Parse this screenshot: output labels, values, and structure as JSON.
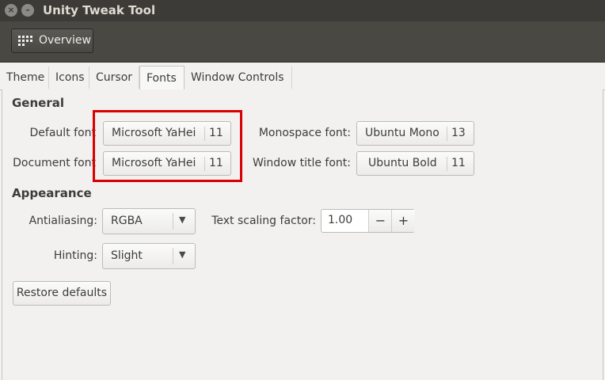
{
  "window": {
    "title": "Unity Tweak Tool"
  },
  "toolbar": {
    "overview_label": "Overview"
  },
  "tabs": [
    {
      "label": "Theme"
    },
    {
      "label": "Icons"
    },
    {
      "label": "Cursor"
    },
    {
      "label": "Fonts",
      "active": true
    },
    {
      "label": "Window Controls"
    }
  ],
  "general": {
    "heading": "General",
    "default_font": {
      "label": "Default font",
      "name": "Microsoft YaHei",
      "size": "11"
    },
    "document_font": {
      "label": "Document font",
      "name": "Microsoft YaHei",
      "size": "11"
    },
    "monospace_font": {
      "label": "Monospace font:",
      "name": "Ubuntu Mono",
      "size": "13"
    },
    "window_title_font": {
      "label": "Window title font:",
      "name": "Ubuntu Bold",
      "size": "11"
    }
  },
  "appearance": {
    "heading": "Appearance",
    "antialiasing": {
      "label": "Antialiasing:",
      "value": "RGBA"
    },
    "hinting": {
      "label": "Hinting:",
      "value": "Slight"
    },
    "text_scaling": {
      "label": "Text scaling factor:",
      "value": "1.00",
      "minus": "−",
      "plus": "+"
    }
  },
  "restore_label": "Restore defaults",
  "colors": {
    "highlight": "#d90000",
    "titlebar": "#3c3b37",
    "toolbar": "#494843"
  }
}
